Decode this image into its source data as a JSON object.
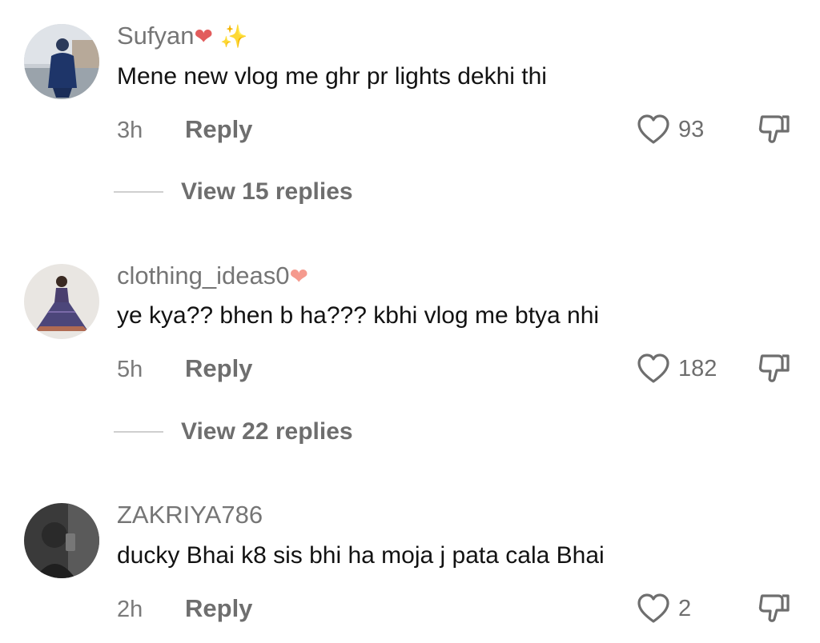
{
  "comments": [
    {
      "username": "Sufyan",
      "emoji1": "❤",
      "emoji2": "✨",
      "text": "Mene new vlog me ghr pr lights dekhi thi",
      "time": "3h",
      "reply_label": "Reply",
      "likes": "93",
      "view_replies": "View 15 replies"
    },
    {
      "username": "clothing_ideas0",
      "emoji1": "❤",
      "text": "ye kya?? bhen b ha??? kbhi vlog me btya nhi",
      "time": "5h",
      "reply_label": "Reply",
      "likes": "182",
      "view_replies": "View 22 replies"
    },
    {
      "username": "ZAKRIYA786",
      "text": "ducky Bhai k8 sis bhi ha moja j pata cala Bhai",
      "time": "2h",
      "reply_label": "Reply",
      "likes": "2"
    }
  ],
  "icons": {
    "like": "heart-outline-icon",
    "dislike": "thumbs-down-outline-icon"
  },
  "colors": {
    "username": "#757575",
    "text": "#121212",
    "meta": "#6e6e6e",
    "divider": "#cfcfcf"
  }
}
